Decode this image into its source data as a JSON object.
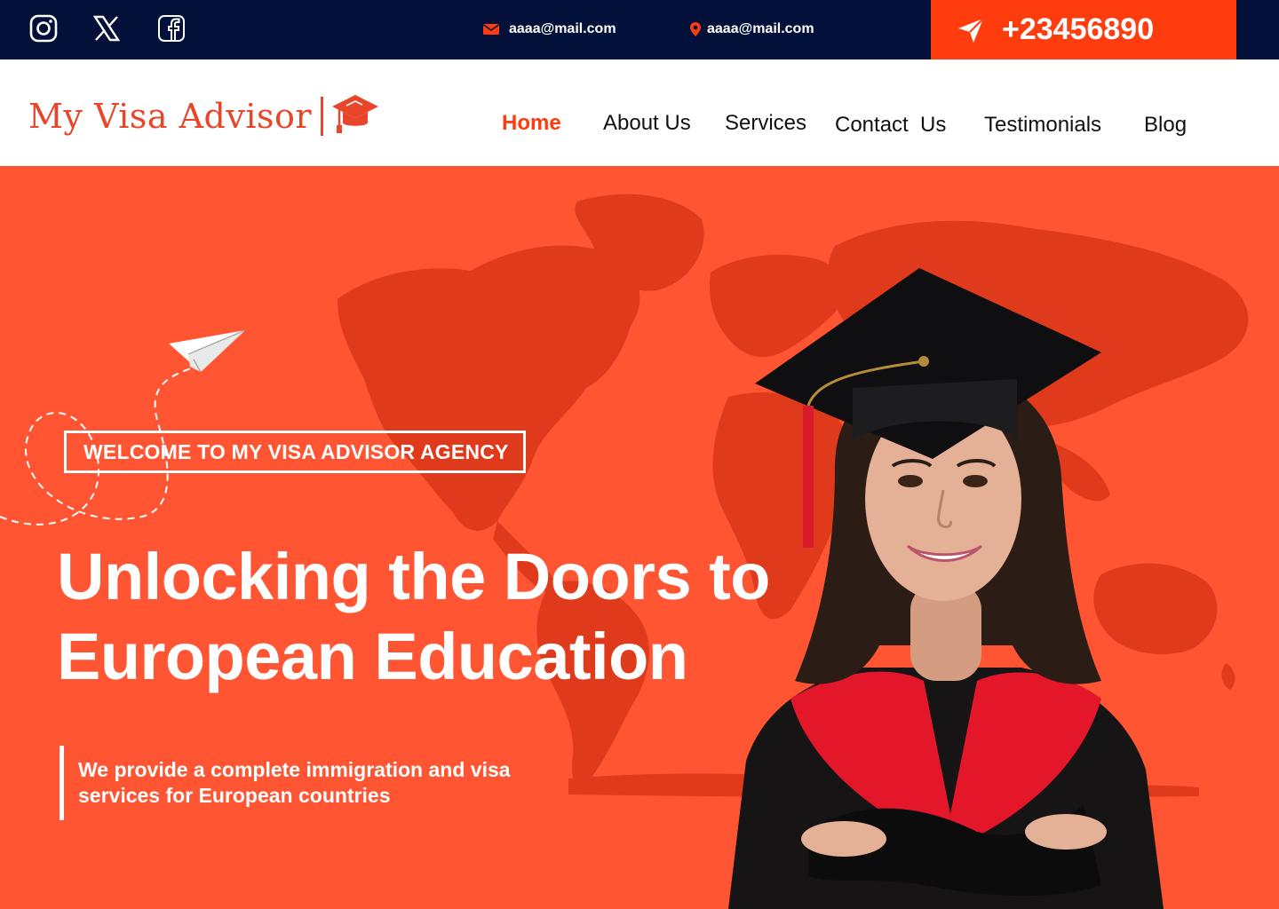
{
  "topbar": {
    "social": [
      {
        "name": "instagram-icon"
      },
      {
        "name": "x-twitter-icon"
      },
      {
        "name": "facebook-icon"
      }
    ],
    "email": "aaaa@mail.com",
    "location": "aaaa@mail.com",
    "phone": "+23456890"
  },
  "brand": {
    "name": "My Visa Advisor",
    "icon": "graduation-cap-icon"
  },
  "nav": {
    "items": [
      {
        "label": "Home",
        "active": true
      },
      {
        "label": "About Us",
        "active": false
      },
      {
        "label": "Services",
        "active": false
      },
      {
        "label": "Contact  Us",
        "active": false
      },
      {
        "label": "Testimonials",
        "active": false
      },
      {
        "label": "Blog",
        "active": false
      }
    ]
  },
  "hero": {
    "badge": "WELCOME TO MY VISA ADVISOR AGENCY",
    "headline": "Unlocking the Doors to European Education",
    "subtext": "We provide a complete immigration and visa services for  European countries"
  },
  "colors": {
    "topbar_bg": "#02103a",
    "accent": "#ff3c0e",
    "hero_bg": "#ff5533",
    "map": "#e03a1c"
  }
}
